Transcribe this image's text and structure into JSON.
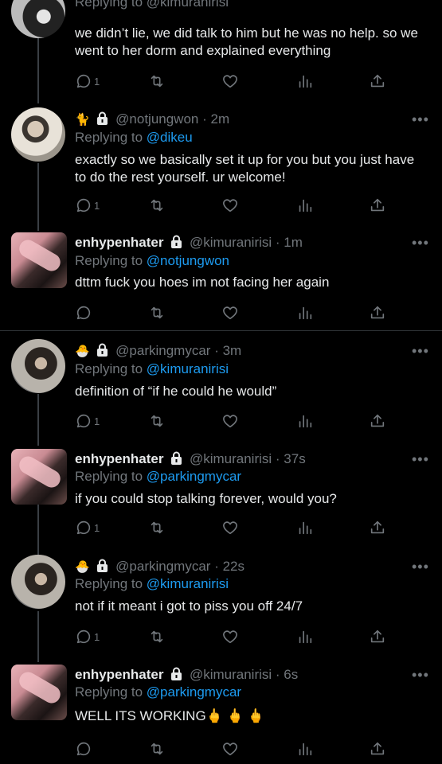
{
  "top_tweet": {
    "reply_partial": "Replying to @kimuranirisi",
    "text": "we didn’t lie, we did talk to him but he was no help. so we went to her dorm and explained everything",
    "reply_count": "1"
  },
  "tweets": [
    {
      "emoji": "🐈",
      "name": "",
      "handle": "@notjungwon",
      "time": "· 2m",
      "reply_label": "Replying to",
      "mention": "@dikeu",
      "text": "exactly so we basically set it up for you but you just have to do the rest yourself. ur welcome!",
      "reply_count": "1"
    },
    {
      "emoji": "",
      "name": "enhypenhater",
      "handle": "@kimuranirisi",
      "time": "· 1m",
      "reply_label": "Replying to",
      "mention": "@notjungwon",
      "text": "dttm fuck you hoes im not facing her again",
      "reply_count": ""
    },
    {
      "emoji": "🐣",
      "name": "",
      "handle": "@parkingmycar",
      "time": "· 3m",
      "reply_label": "Replying to",
      "mention": "@kimuranirisi",
      "text": "definition of “if he could he would”",
      "reply_count": "1"
    },
    {
      "emoji": "",
      "name": "enhypenhater",
      "handle": "@kimuranirisi",
      "time": "· 37s",
      "reply_label": "Replying to",
      "mention": "@parkingmycar",
      "text": "if you could stop talking forever, would you?",
      "reply_count": "1"
    },
    {
      "emoji": "🐣",
      "name": "",
      "handle": "@parkingmycar",
      "time": "· 22s",
      "reply_label": "Replying to",
      "mention": "@kimuranirisi",
      "text": "not if it meant i got to piss you off 24/7",
      "reply_count": "1"
    },
    {
      "emoji": "",
      "name": "enhypenhater",
      "handle": "@kimuranirisi",
      "time": "· 6s",
      "reply_label": "Replying to",
      "mention": "@parkingmycar",
      "text": "WELL ITS WORKING",
      "text_emoji": "🖕 🖕 🖕",
      "reply_count": ""
    }
  ],
  "more_label": "•••"
}
